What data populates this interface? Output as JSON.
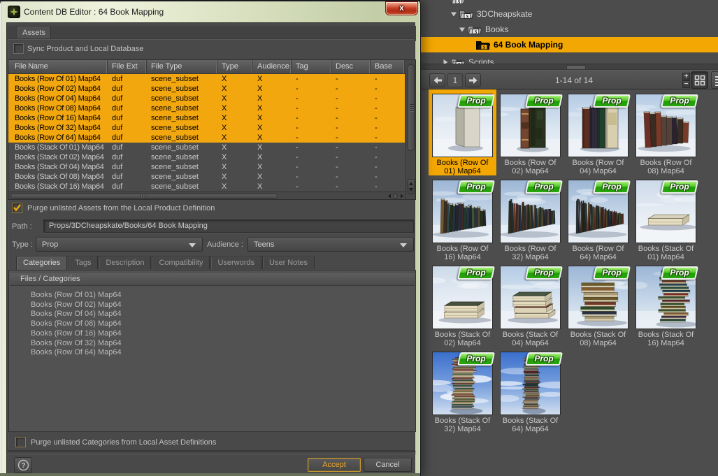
{
  "colors": {
    "accent_orange": "#f2a70e",
    "badge_green": "#2aa70e",
    "glass": "#dde4c6",
    "close_red": "#c33a22"
  },
  "dialog": {
    "title": "Content DB Editor : 64 Book Mapping",
    "close_glyph": "x",
    "main_tab": "Assets",
    "sync_checkbox_label": "Sync Product and Local Database",
    "sync_checked": false,
    "table": {
      "columns": [
        "File Name",
        "File Ext",
        "File Type",
        "Type",
        "Audience",
        "Tag",
        "Desc",
        "Base"
      ],
      "rows": [
        {
          "name": "Books (Row Of 01) Map64",
          "ext": "duf",
          "ftype": "scene_subset",
          "type": "X",
          "audience": "X",
          "tag": "-",
          "desc": "-",
          "base": "-",
          "selected": true
        },
        {
          "name": "Books (Row Of 02) Map64",
          "ext": "duf",
          "ftype": "scene_subset",
          "type": "X",
          "audience": "X",
          "tag": "-",
          "desc": "-",
          "base": "-",
          "selected": true
        },
        {
          "name": "Books (Row Of 04) Map64",
          "ext": "duf",
          "ftype": "scene_subset",
          "type": "X",
          "audience": "X",
          "tag": "-",
          "desc": "-",
          "base": "-",
          "selected": true
        },
        {
          "name": "Books (Row Of 08) Map64",
          "ext": "duf",
          "ftype": "scene_subset",
          "type": "X",
          "audience": "X",
          "tag": "-",
          "desc": "-",
          "base": "-",
          "selected": true
        },
        {
          "name": "Books (Row Of 16) Map64",
          "ext": "duf",
          "ftype": "scene_subset",
          "type": "X",
          "audience": "X",
          "tag": "-",
          "desc": "-",
          "base": "-",
          "selected": true
        },
        {
          "name": "Books (Row Of 32) Map64",
          "ext": "duf",
          "ftype": "scene_subset",
          "type": "X",
          "audience": "X",
          "tag": "-",
          "desc": "-",
          "base": "-",
          "selected": true
        },
        {
          "name": "Books (Row Of 64) Map64",
          "ext": "duf",
          "ftype": "scene_subset",
          "type": "X",
          "audience": "X",
          "tag": "-",
          "desc": "-",
          "base": "-",
          "selected": true
        },
        {
          "name": "Books (Stack Of 01) Map64",
          "ext": "duf",
          "ftype": "scene_subset",
          "type": "X",
          "audience": "X",
          "tag": "-",
          "desc": "-",
          "base": "-",
          "selected": false
        },
        {
          "name": "Books (Stack Of 02) Map64",
          "ext": "duf",
          "ftype": "scene_subset",
          "type": "X",
          "audience": "X",
          "tag": "-",
          "desc": "-",
          "base": "-",
          "selected": false
        },
        {
          "name": "Books (Stack Of 04) Map64",
          "ext": "duf",
          "ftype": "scene_subset",
          "type": "X",
          "audience": "X",
          "tag": "-",
          "desc": "-",
          "base": "-",
          "selected": false
        },
        {
          "name": "Books (Stack Of 08) Map64",
          "ext": "duf",
          "ftype": "scene_subset",
          "type": "X",
          "audience": "X",
          "tag": "-",
          "desc": "-",
          "base": "-",
          "selected": false
        },
        {
          "name": "Books (Stack Of 16) Map64",
          "ext": "duf",
          "ftype": "scene_subset",
          "type": "X",
          "audience": "X",
          "tag": "-",
          "desc": "-",
          "base": "-",
          "selected": false
        }
      ]
    },
    "purge_assets_label": "Purge unlisted Assets from the Local Product Definition",
    "purge_assets_checked": true,
    "path_label": "Path :",
    "path_value": "Props/3DCheapskate/Books/64 Book Mapping",
    "type_label": "Type :",
    "type_value": "Prop",
    "audience_label": "Audience :",
    "audience_value": "Teens",
    "sub_tabs": [
      "Categories",
      "Tags",
      "Description",
      "Compatibility",
      "Userwords",
      "User Notes"
    ],
    "active_sub_tab": "Categories",
    "files_header": "Files / Categories",
    "category_files": [
      "Books (Row Of 01) Map64",
      "Books (Row Of 02) Map64",
      "Books (Row Of 04) Map64",
      "Books (Row Of 08) Map64",
      "Books (Row Of 16) Map64",
      "Books (Row Of 32) Map64",
      "Books (Row Of 64) Map64"
    ],
    "purge_categories_label": "Purge unlisted Categories from Local Asset Definitions",
    "purge_categories_checked": false,
    "help_glyph": "?",
    "accept_label": "Accept",
    "cancel_label": "Cancel"
  },
  "panel": {
    "tree": [
      {
        "label": "",
        "depth": 0,
        "partial_top": true
      },
      {
        "label": "3DCheapskate",
        "depth": 1,
        "expanded": true
      },
      {
        "label": "Books",
        "depth": 2,
        "expanded": true
      },
      {
        "label": "64 Book Mapping",
        "depth": 3,
        "selected": true
      },
      {
        "label": "Scripts",
        "depth": 0,
        "expanded": false,
        "partial_bottom": true
      }
    ],
    "nav": {
      "page": "1",
      "count_text": "1-14 of 14"
    },
    "badge_label": "Prop",
    "thumbnails": [
      {
        "line1": "Books (Row Of",
        "line2": "01) Map64",
        "kind": "row",
        "n": 1,
        "sky": "pale",
        "selected": true
      },
      {
        "line1": "Books (Row Of",
        "line2": "02) Map64",
        "kind": "row",
        "n": 2,
        "sky": "light",
        "selected": false
      },
      {
        "line1": "Books (Row Of",
        "line2": "04) Map64",
        "kind": "row",
        "n": 4,
        "sky": "light",
        "selected": false
      },
      {
        "line1": "Books (Row Of",
        "line2": "08) Map64",
        "kind": "row",
        "n": 8,
        "sky": "light",
        "selected": false
      },
      {
        "line1": "Books (Row Of",
        "line2": "16) Map64",
        "kind": "row",
        "n": 16,
        "sky": "mid",
        "selected": false
      },
      {
        "line1": "Books (Row Of",
        "line2": "32) Map64",
        "kind": "row",
        "n": 32,
        "sky": "mid",
        "selected": false
      },
      {
        "line1": "Books (Row Of",
        "line2": "64) Map64",
        "kind": "row",
        "n": 64,
        "sky": "mid",
        "selected": false
      },
      {
        "line1": "Books (Stack Of",
        "line2": "01) Map64",
        "kind": "stack",
        "n": 1,
        "sky": "pale",
        "selected": false
      },
      {
        "line1": "Books (Stack Of",
        "line2": "02) Map64",
        "kind": "stack",
        "n": 2,
        "sky": "pale",
        "selected": false
      },
      {
        "line1": "Books (Stack Of",
        "line2": "04) Map64",
        "kind": "stack",
        "n": 4,
        "sky": "light",
        "selected": false
      },
      {
        "line1": "Books (Stack Of",
        "line2": "08) Map64",
        "kind": "stack",
        "n": 8,
        "sky": "mid",
        "selected": false
      },
      {
        "line1": "Books (Stack Of",
        "line2": "16) Map64",
        "kind": "stack",
        "n": 16,
        "sky": "mid",
        "selected": false
      },
      {
        "line1": "Books (Stack Of",
        "line2": "32) Map64",
        "kind": "stack",
        "n": 32,
        "sky": "deep",
        "selected": false
      },
      {
        "line1": "Books (Stack Of",
        "line2": "64) Map64",
        "kind": "stack",
        "n": 64,
        "sky": "deep",
        "selected": false
      }
    ]
  }
}
